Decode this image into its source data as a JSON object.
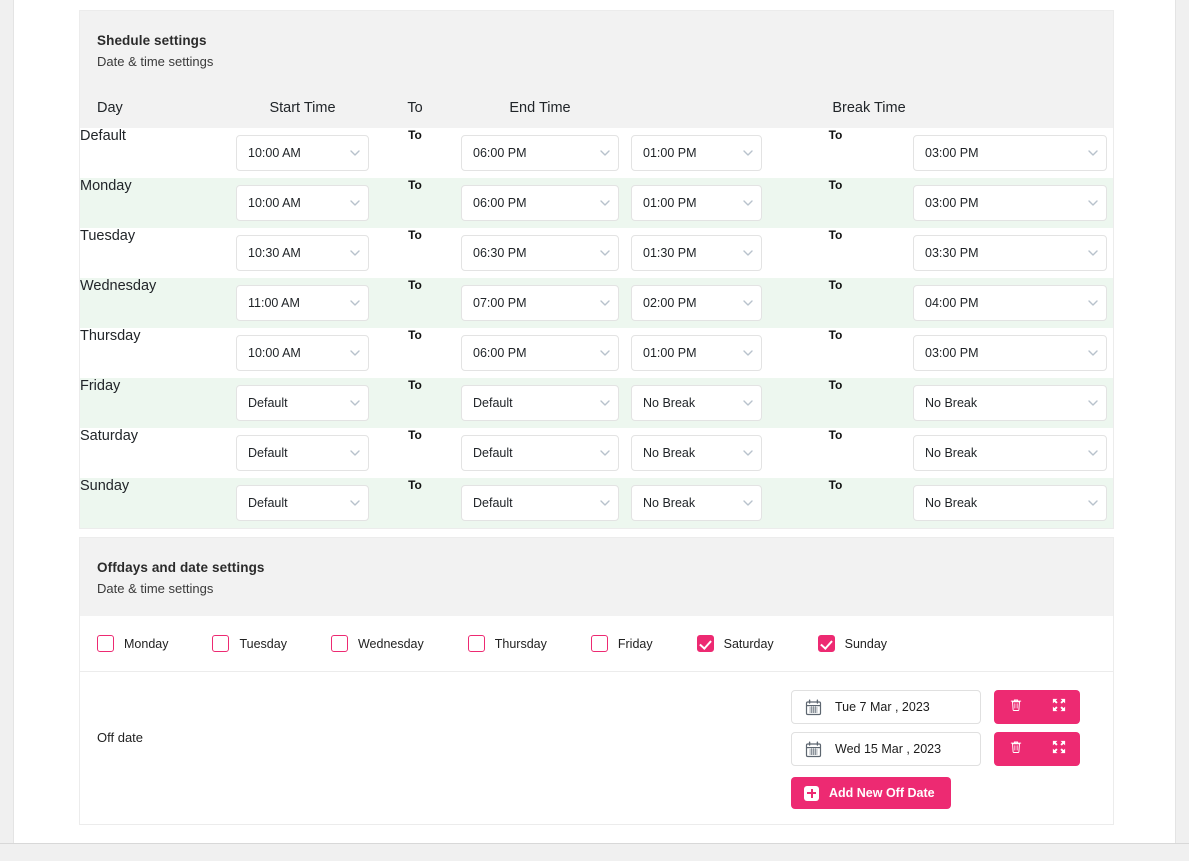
{
  "theme": {
    "accent": "#ed2a72",
    "row_alt_bg": "#edf7ef",
    "card_head_bg": "#f2f2f2"
  },
  "schedule_card": {
    "title": "Shedule settings",
    "subtitle": "Date & time settings",
    "columns": {
      "day": "Day",
      "start_time": "Start Time",
      "to": "To",
      "end_time": "End Time",
      "break_time": "Break Time"
    },
    "to_label": "To",
    "rows": [
      {
        "day": "Default",
        "start": "10:00 AM",
        "to1": "To",
        "end": "06:00 PM",
        "break_start": "01:00 PM",
        "to2": "To",
        "break_end": "03:00 PM"
      },
      {
        "day": "Monday",
        "start": "10:00 AM",
        "to1": "To",
        "end": "06:00 PM",
        "break_start": "01:00 PM",
        "to2": "To",
        "break_end": "03:00 PM"
      },
      {
        "day": "Tuesday",
        "start": "10:30 AM",
        "to1": "To",
        "end": "06:30 PM",
        "break_start": "01:30 PM",
        "to2": "To",
        "break_end": "03:30 PM"
      },
      {
        "day": "Wednesday",
        "start": "11:00 AM",
        "to1": "To",
        "end": "07:00 PM",
        "break_start": "02:00 PM",
        "to2": "To",
        "break_end": "04:00 PM"
      },
      {
        "day": "Thursday",
        "start": "10:00 AM",
        "to1": "To",
        "end": "06:00 PM",
        "break_start": "01:00 PM",
        "to2": "To",
        "break_end": "03:00 PM"
      },
      {
        "day": "Friday",
        "start": "Default",
        "to1": "To",
        "end": "Default",
        "break_start": "No Break",
        "to2": "To",
        "break_end": "No Break"
      },
      {
        "day": "Saturday",
        "start": "Default",
        "to1": "To",
        "end": "Default",
        "break_start": "No Break",
        "to2": "To",
        "break_end": "No Break"
      },
      {
        "day": "Sunday",
        "start": "Default",
        "to1": "To",
        "end": "Default",
        "break_start": "No Break",
        "to2": "To",
        "break_end": "No Break"
      }
    ]
  },
  "offdays_card": {
    "title": "Offdays and date settings",
    "subtitle": "Date & time settings",
    "day_checkboxes": [
      {
        "label": "Monday",
        "checked": false
      },
      {
        "label": "Tuesday",
        "checked": false
      },
      {
        "label": "Wednesday",
        "checked": false
      },
      {
        "label": "Thursday",
        "checked": false
      },
      {
        "label": "Friday",
        "checked": false
      },
      {
        "label": "Saturday",
        "checked": true
      },
      {
        "label": "Sunday",
        "checked": true
      }
    ],
    "off_date_label": "Off date",
    "off_dates": [
      {
        "value": "Tue 7 Mar , 2023",
        "icon": "calendar-icon",
        "delete_icon": "trash-icon",
        "expand_icon": "expand-arrows-icon"
      },
      {
        "value": "Wed 15 Mar , 2023",
        "icon": "calendar-icon",
        "delete_icon": "trash-icon",
        "expand_icon": "expand-arrows-icon"
      }
    ],
    "add_button_label": "Add New Off Date",
    "add_button_icon": "plus-square-icon"
  }
}
